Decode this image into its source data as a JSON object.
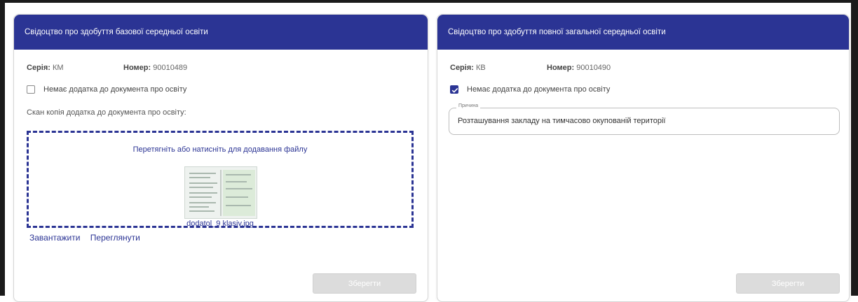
{
  "left_card": {
    "title": "Свідоцтво про здобуття базової середньої освіти",
    "serial_label": "Серія:",
    "serial_value": "КМ",
    "number_label": "Номер:",
    "number_value": "90010489",
    "no_supplement_checked": false,
    "no_supplement_label": "Немає додатка до документа про освіту",
    "scan_label": "Скан копія додатка до документа про освіту:",
    "dropzone_text": "Перетягніть або натисніть для додавання файлу",
    "file_name": "dodatol_9 klasiv.jpg",
    "download_label": "Завантажити",
    "view_label": "Переглянути",
    "save_label": "Зберегти"
  },
  "right_card": {
    "title": "Свідоцтво про здобуття повної загальної середньої освіти",
    "serial_label": "Серія:",
    "serial_value": "КВ",
    "number_label": "Номер:",
    "number_value": "90010490",
    "no_supplement_checked": true,
    "no_supplement_label": "Немає додатка до документа про освіту",
    "reason_label": "Причина",
    "reason_value": "Розташування закладу на тимчасово окупованій території",
    "save_label": "Зберегти"
  },
  "colors": {
    "header": "#2b3494",
    "accent": "#2b3494",
    "disabled_button": "#dcdcdc"
  }
}
